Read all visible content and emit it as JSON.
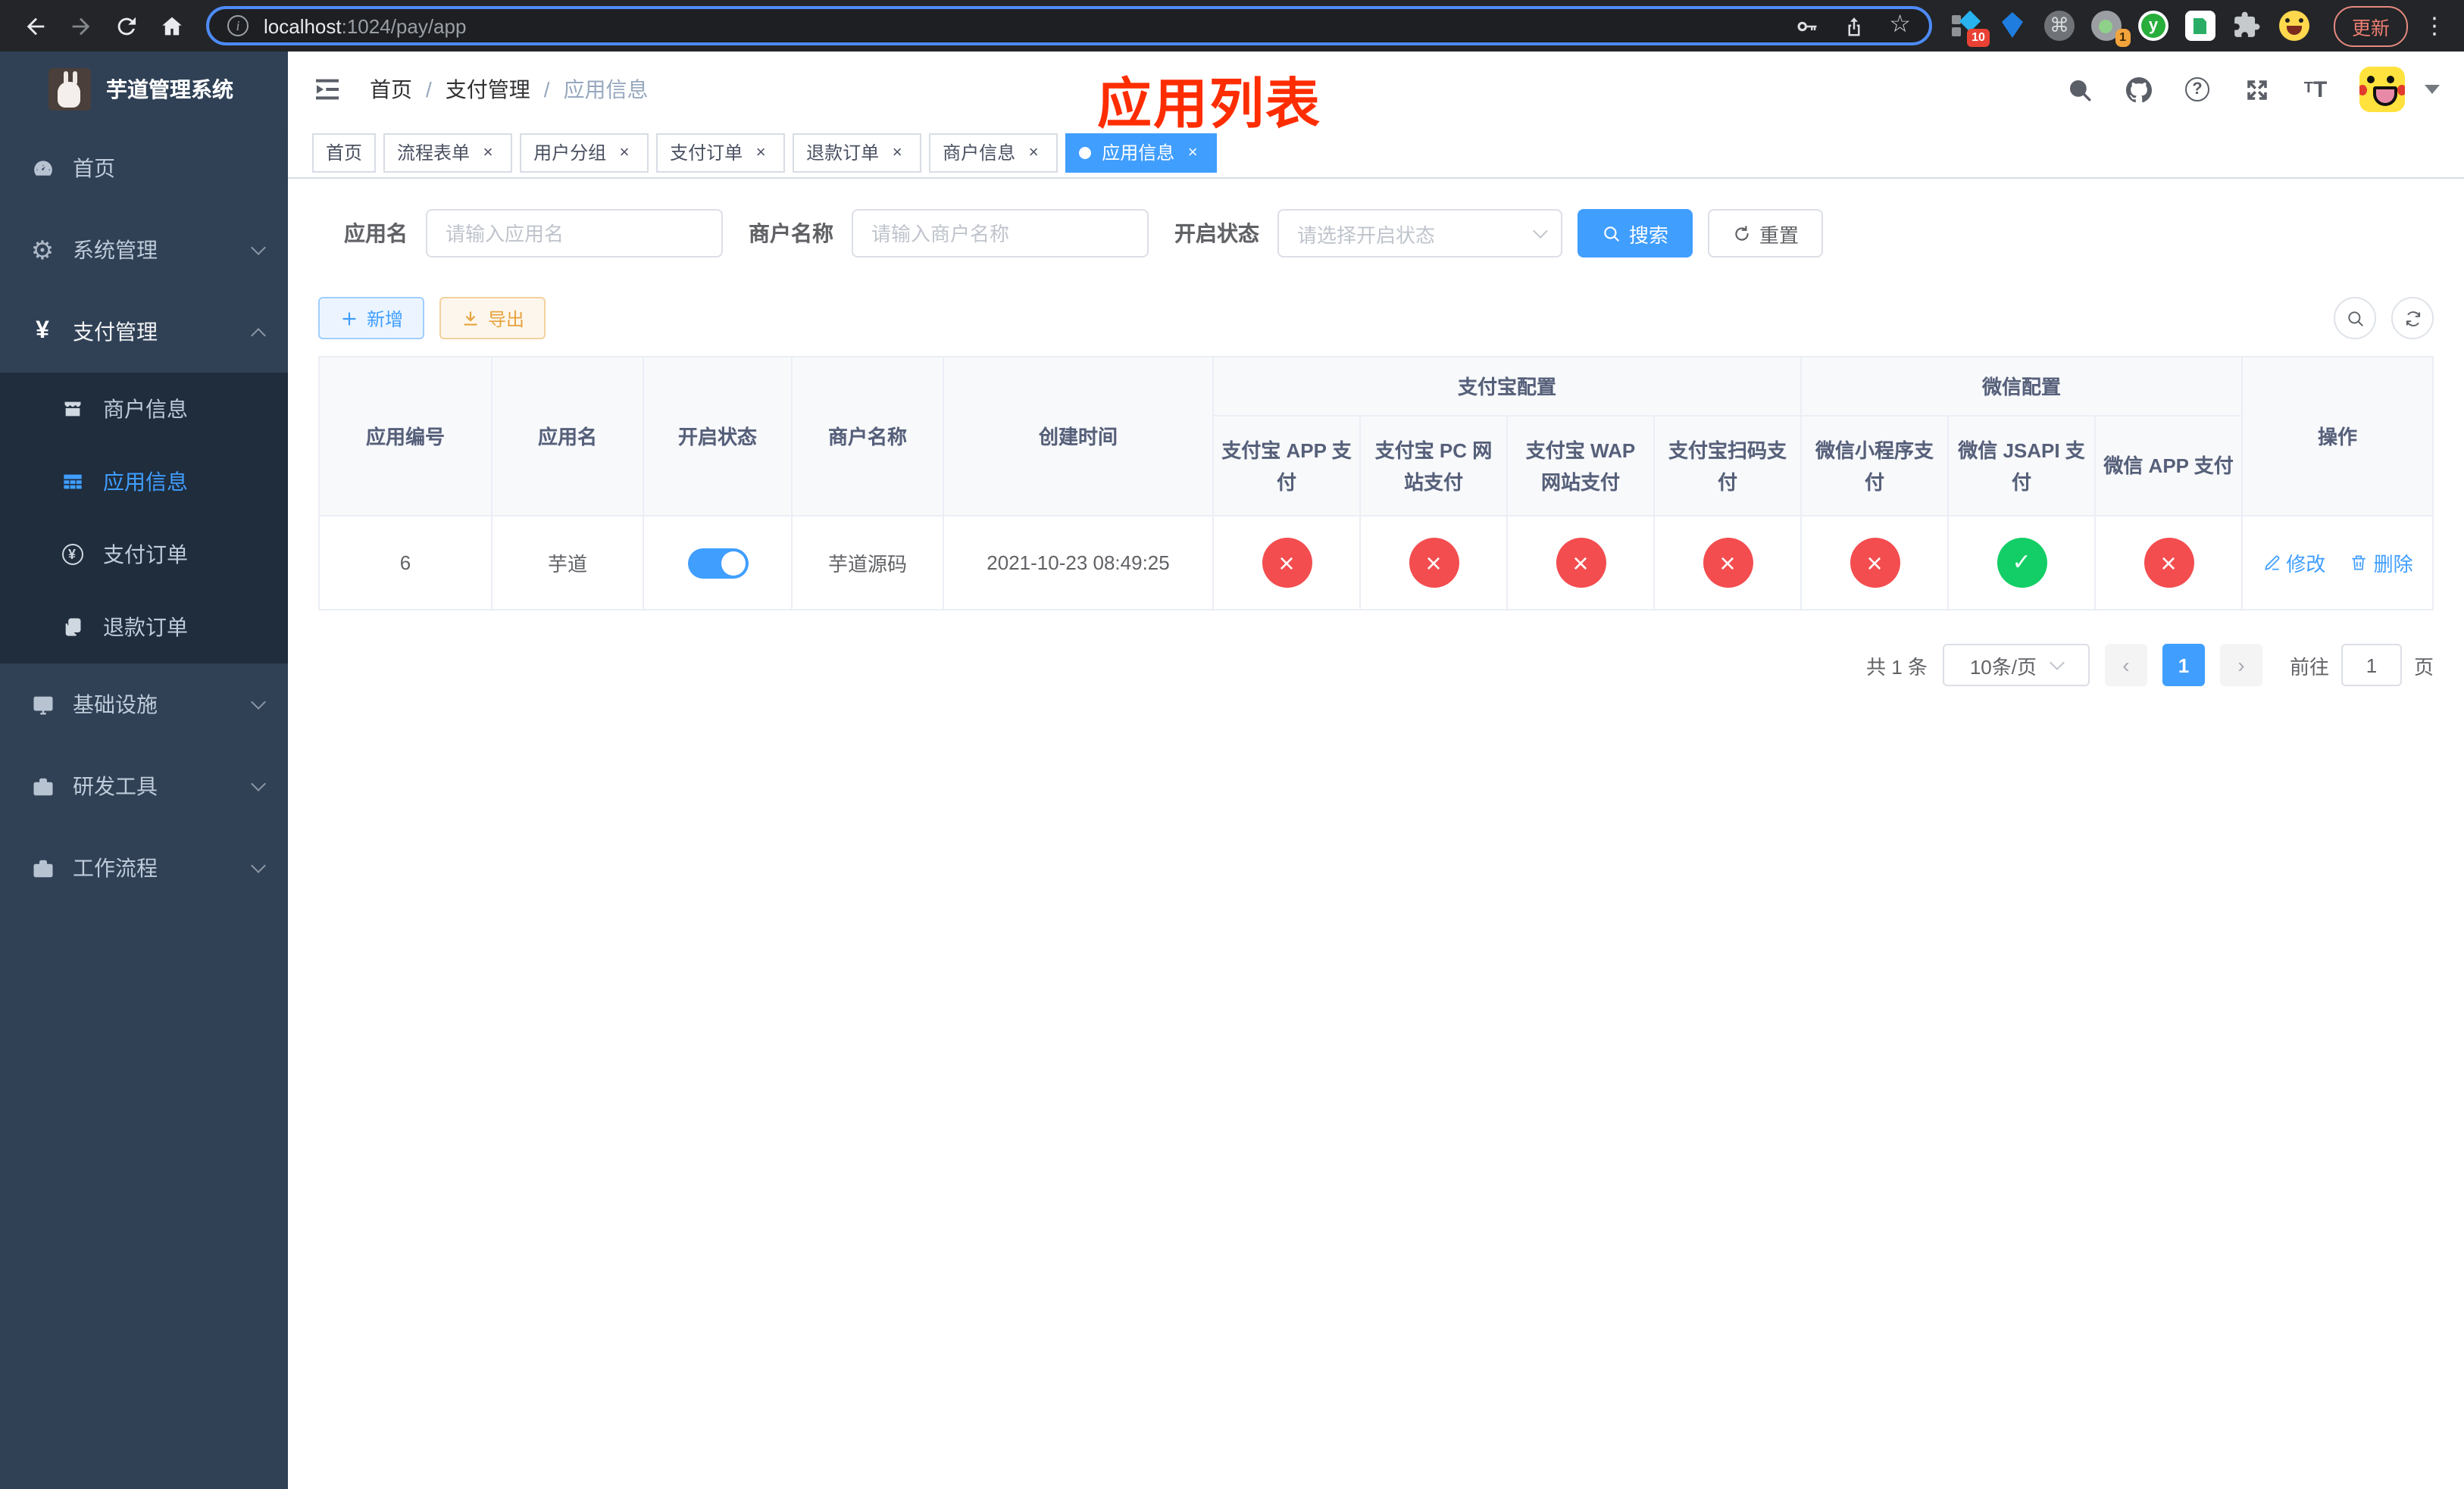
{
  "browser": {
    "url_host": "localhost",
    "url_path": ":1024/pay/app",
    "ext_badge_1": "10",
    "ext_badge_2": "1",
    "update_label": "更新"
  },
  "sidebar": {
    "title": "芋道管理系统",
    "menu": {
      "home": "首页",
      "system": "系统管理",
      "payment": "支付管理",
      "infra": "基础设施",
      "devtools": "研发工具",
      "workflow": "工作流程"
    },
    "submenu": {
      "merchant": "商户信息",
      "app": "应用信息",
      "pay_order": "支付订单",
      "refund_order": "退款订单"
    },
    "colors": {
      "bg": "#304156",
      "submenu_bg": "#1f2d3d",
      "active": "#409eff"
    }
  },
  "header": {
    "breadcrumb": [
      "首页",
      "支付管理",
      "应用信息"
    ],
    "annotation": "应用列表",
    "annotation_color": "#fe2d00"
  },
  "tabs": [
    {
      "label": "首页",
      "closable": false,
      "active": false
    },
    {
      "label": "流程表单",
      "closable": true,
      "active": false
    },
    {
      "label": "用户分组",
      "closable": true,
      "active": false
    },
    {
      "label": "支付订单",
      "closable": true,
      "active": false
    },
    {
      "label": "退款订单",
      "closable": true,
      "active": false
    },
    {
      "label": "商户信息",
      "closable": true,
      "active": false
    },
    {
      "label": "应用信息",
      "closable": true,
      "active": true
    }
  ],
  "filters": {
    "app_name_label": "应用名",
    "app_name_placeholder": "请输入应用名",
    "merchant_label": "商户名称",
    "merchant_placeholder": "请输入商户名称",
    "status_label": "开启状态",
    "status_placeholder": "请选择开启状态",
    "search_label": "搜索",
    "reset_label": "重置"
  },
  "toolbar": {
    "add_label": "新增",
    "export_label": "导出"
  },
  "table": {
    "columns": {
      "app_id": "应用编号",
      "app_name": "应用名",
      "status": "开启状态",
      "merchant_name": "商户名称",
      "create_time": "创建时间",
      "op": "操作"
    },
    "groups": {
      "alipay": "支付宝配置",
      "wechat": "微信配置"
    },
    "sub_columns": [
      "支付宝 APP 支付",
      "支付宝 PC 网站支付",
      "支付宝 WAP 网站支付",
      "支付宝扫码支付",
      "微信小程序支付",
      "微信 JSAPI 支付",
      "微信 APP 支付"
    ],
    "row": {
      "app_id": "6",
      "app_name": "芋道",
      "switch": "on",
      "merchant_name": "芋道源码",
      "create_time": "2021-10-23 08:49:25",
      "channels": [
        "disabled",
        "disabled",
        "disabled",
        "disabled",
        "disabled",
        "enabled",
        "disabled"
      ],
      "edit_label": "修改",
      "delete_label": "删除"
    },
    "status_colors": {
      "enabled": "#13ce66",
      "disabled": "#f34d50"
    }
  },
  "pagination": {
    "total_text": "共 1 条",
    "page_size": "10条/页",
    "current_page": "1",
    "goto_label": "前往",
    "goto_value": "1",
    "page_suffix": "页"
  }
}
